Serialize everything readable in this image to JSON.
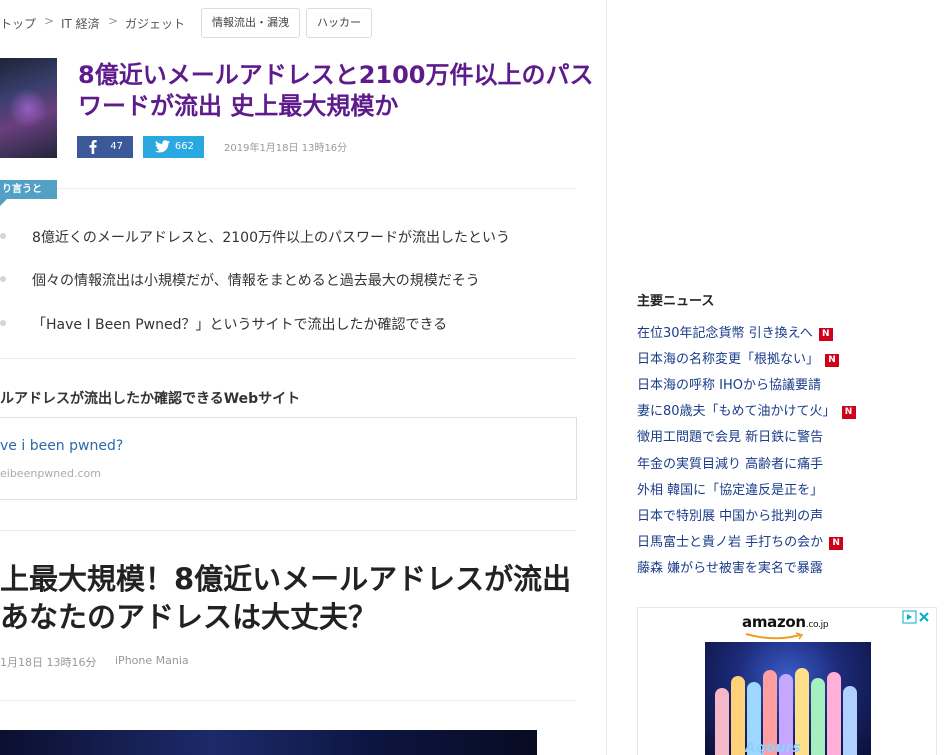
{
  "breadcrumb": {
    "items": [
      "トップ",
      "IT 経済",
      "ガジェット"
    ],
    "tags": [
      "情報流出・漏洩",
      "ハッカー"
    ]
  },
  "article": {
    "headline": "8億近いメールアドレスと2100万件以上のパスワードが流出 史上最大規模か",
    "facebook_count": "47",
    "twitter_count": "662",
    "date": "2019年1月18日 13時16分",
    "summary_label": "り言うと",
    "summary_items": [
      "8億近くのメールアドレスと、2100万件以上のパスワードが流出したという",
      "個々の情報流出は小規模だが、情報をまとめると過去最大の規模だそう",
      "「Have I Been Pwned？」というサイトで流出したか確認できる"
    ],
    "related": {
      "heading": "ルアドレスが流出したか確認できるWebサイト",
      "link_text": "ve i been pwned?",
      "url_text": "eibeenpwned.com"
    }
  },
  "article2": {
    "title_line1": "上最大規模！8億近いメールアドレスが流出",
    "title_line2": "あなたのアドレスは大丈夫？",
    "date": "1月18日 13時16分",
    "source": "iPhone Mania"
  },
  "sidebar": {
    "news_heading": "主要ニュース",
    "news": [
      {
        "title": "在位30年記念貨幣 引き換えへ",
        "badge": "N"
      },
      {
        "title": "日本海の名称変更「根拠ない」",
        "badge": "N"
      },
      {
        "title": "日本海の呼称 IHOから協議要請",
        "badge": ""
      },
      {
        "title": "妻に80歳夫「もめて油かけて火」",
        "badge": "N"
      },
      {
        "title": "徴用工問題で会見 新日鉄に警告",
        "badge": ""
      },
      {
        "title": "年金の実質目減り 高齢者に痛手",
        "badge": ""
      },
      {
        "title": "外相 韓国に「協定違反是正を」",
        "badge": ""
      },
      {
        "title": "日本で特別展 中国から批判の声",
        "badge": ""
      },
      {
        "title": "日馬富士と貴ノ岩 手打ちの会か",
        "badge": "N"
      },
      {
        "title": "藤森 嫌がらせ被害を実名で暴露",
        "badge": ""
      }
    ],
    "ad": {
      "logo": "amazon",
      "logo_suffix": ".co.jp",
      "caption": "Aqours"
    }
  }
}
